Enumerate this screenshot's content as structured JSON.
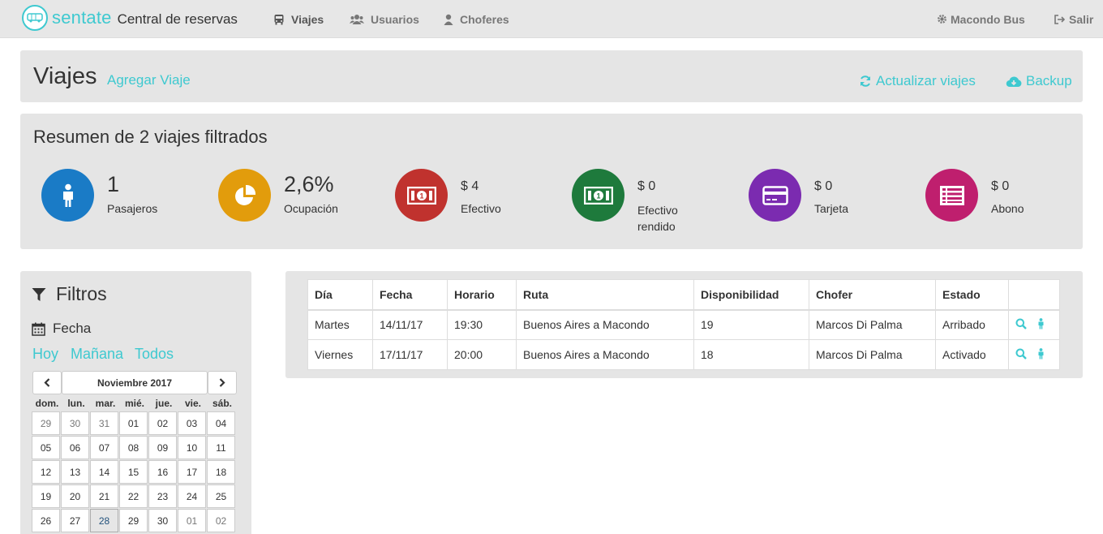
{
  "navbar": {
    "brand_name": "sentate",
    "brand_sub": "Central de reservas",
    "links": [
      "Viajes",
      "Usuarios",
      "Choferes"
    ],
    "company": "Macondo Bus",
    "logout": "Salir"
  },
  "header": {
    "title": "Viajes",
    "add_trip": "Agregar Viaje",
    "refresh": "Actualizar viajes",
    "backup": "Backup"
  },
  "summary": {
    "title": "Resumen de 2 viajes filtrados",
    "stats": [
      {
        "value": "1",
        "label": "Pasajeros",
        "color": "#1a7bc6",
        "icon": "person-icon"
      },
      {
        "value": "2,6%",
        "label": "Ocupación",
        "color": "#e29c0c",
        "icon": "pie-chart-icon"
      },
      {
        "value": "$ 4",
        "label": "Efectivo",
        "color": "#c0322e",
        "icon": "money-icon"
      },
      {
        "value": "$ 0",
        "label": "Efectivo rendido",
        "color": "#1e7a3c",
        "icon": "money-icon"
      },
      {
        "value": "$ 0",
        "label": "Tarjeta",
        "color": "#7b2bb0",
        "icon": "credit-card-icon"
      },
      {
        "value": "$ 0",
        "label": "Abono",
        "color": "#bf1f6e",
        "icon": "list-icon"
      }
    ]
  },
  "filters": {
    "title": "Filtros",
    "date_label": "Fecha",
    "quick": [
      "Hoy",
      "Mañana",
      "Todos"
    ],
    "calendar": {
      "prev": "‹",
      "next": "›",
      "month": "Noviembre 2017",
      "weekdays": [
        "dom.",
        "lun.",
        "mar.",
        "mié.",
        "jue.",
        "vie.",
        "sáb."
      ],
      "weeks": [
        [
          "29",
          "30",
          "31",
          "01",
          "02",
          "03",
          "04"
        ],
        [
          "05",
          "06",
          "07",
          "08",
          "09",
          "10",
          "11"
        ],
        [
          "12",
          "13",
          "14",
          "15",
          "16",
          "17",
          "18"
        ],
        [
          "19",
          "20",
          "21",
          "22",
          "23",
          "24",
          "25"
        ],
        [
          "26",
          "27",
          "28",
          "29",
          "30",
          "01",
          "02"
        ]
      ],
      "selected": "28"
    }
  },
  "trips": {
    "columns": [
      "Día",
      "Fecha",
      "Horario",
      "Ruta",
      "Disponibilidad",
      "Chofer",
      "Estado",
      ""
    ],
    "rows": [
      {
        "day": "Martes",
        "date": "14/11/17",
        "time": "19:30",
        "route": "Buenos Aires a Macondo",
        "available": "19",
        "driver": "Marcos Di Palma",
        "status": "Arribado"
      },
      {
        "day": "Viernes",
        "date": "17/11/17",
        "time": "20:00",
        "route": "Buenos Aires a Macondo",
        "available": "18",
        "driver": "Marcos Di Palma",
        "status": "Activado"
      }
    ]
  },
  "accent_color": "#3ec9d0"
}
